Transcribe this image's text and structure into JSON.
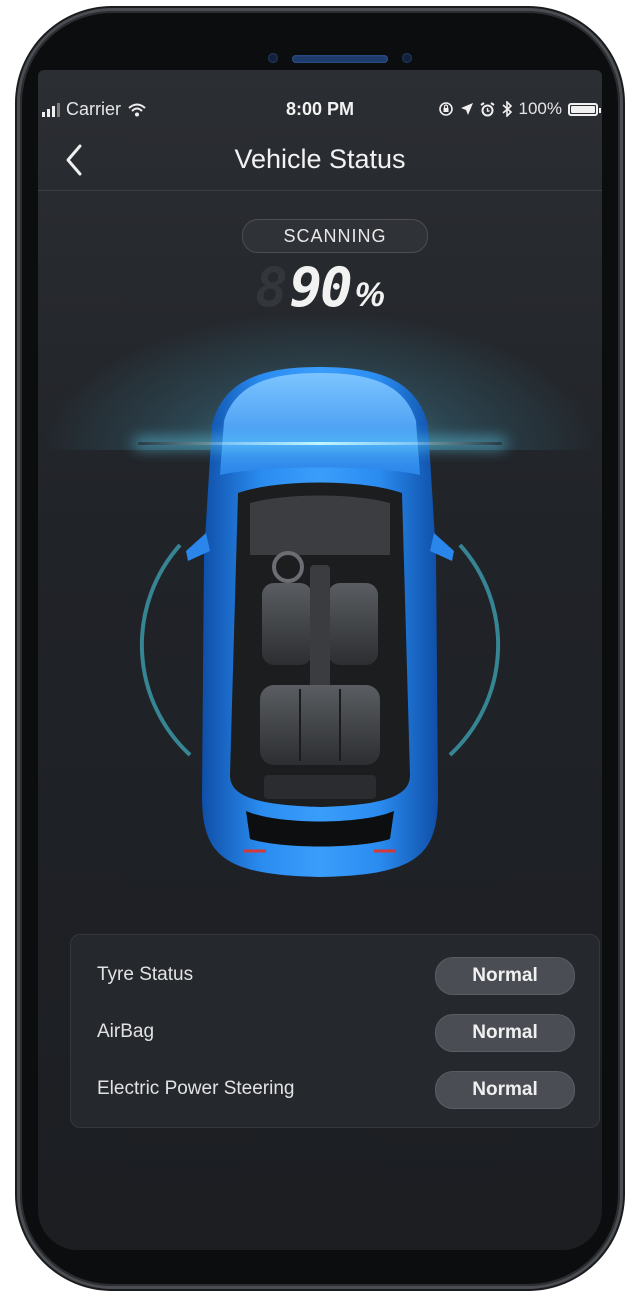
{
  "status_bar": {
    "carrier": "Carrier",
    "time": "8:00 PM",
    "battery": "100%",
    "icons": [
      "signal-bars-icon",
      "wifi-icon",
      "lock-rotation-icon",
      "location-arrow-icon",
      "alarm-icon",
      "bluetooth-icon",
      "battery-icon"
    ]
  },
  "nav": {
    "title": "Vehicle Status",
    "back_icon": "chevron-left-icon"
  },
  "scan": {
    "state": "SCANNING",
    "progress": "90",
    "unit": "%",
    "accent_color": "#5fd6f0"
  },
  "car": {
    "color": "#1f78d6",
    "icon": "car-top-view-icon"
  },
  "checks": [
    {
      "label": "Tyre Status",
      "status": "Normal"
    },
    {
      "label": "AirBag",
      "status": "Normal"
    },
    {
      "label": "Electric Power Steering",
      "status": "Normal"
    }
  ]
}
